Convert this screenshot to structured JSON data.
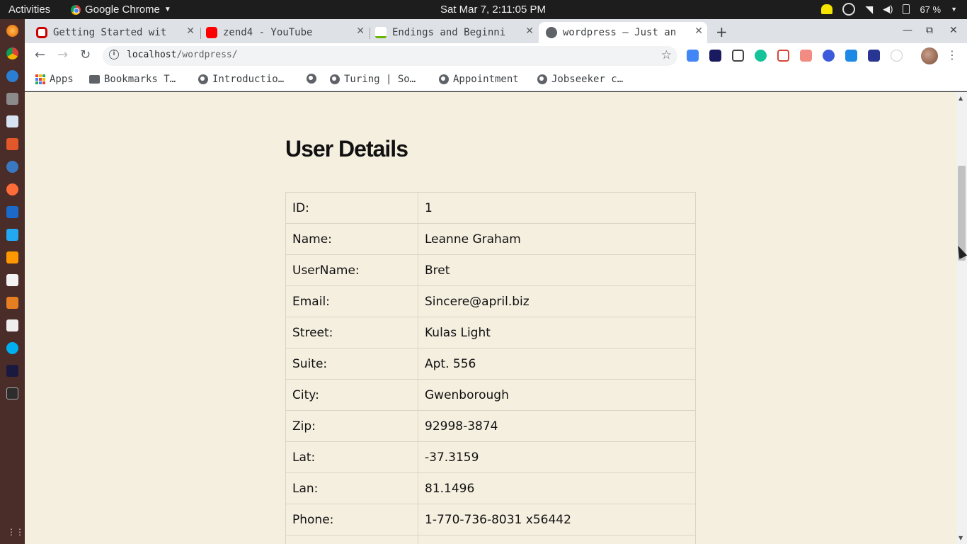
{
  "topbar": {
    "activities": "Activities",
    "app_name": "Google Chrome",
    "clock": "Sat Mar  7,  2:11:05 PM",
    "battery": "67 %"
  },
  "tabs": [
    {
      "title": "Getting Started wit",
      "icon": "oracle-icon"
    },
    {
      "title": "zend4 - YouTube",
      "icon": "youtube-icon"
    },
    {
      "title": "Endings and Beginni",
      "icon": "zend-icon"
    },
    {
      "title": "wordpress – Just an",
      "icon": "globe-icon",
      "active": true
    }
  ],
  "omnibox": {
    "host": "localhost",
    "path": "/wordpress/"
  },
  "bookmarks": [
    {
      "label": "Apps",
      "icon": "apps-grid-icon"
    },
    {
      "label": "Bookmarks T…",
      "icon": "folder-icon"
    },
    {
      "label": "Introductio…",
      "icon": "globe-icon"
    },
    {
      "label": "",
      "icon": "globe-icon"
    },
    {
      "label": "Turing | So…",
      "icon": "globe-icon"
    },
    {
      "label": "Appointment",
      "icon": "globe-icon"
    },
    {
      "label": "Jobseeker c…",
      "icon": "globe-icon"
    }
  ],
  "page": {
    "heading": "User Details",
    "rows": [
      {
        "key": "ID:",
        "value": "1"
      },
      {
        "key": "Name:",
        "value": "Leanne Graham"
      },
      {
        "key": "UserName:",
        "value": "Bret"
      },
      {
        "key": "Email:",
        "value": "Sincere@april.biz"
      },
      {
        "key": "Street:",
        "value": "Kulas Light"
      },
      {
        "key": "Suite:",
        "value": "Apt. 556"
      },
      {
        "key": "City:",
        "value": "Gwenborough"
      },
      {
        "key": "Zip:",
        "value": "92998-3874"
      },
      {
        "key": "Lat:",
        "value": "-37.3159"
      },
      {
        "key": "Lan:",
        "value": "81.1496"
      },
      {
        "key": "Phone:",
        "value": "1-770-736-8031 x56442"
      },
      {
        "key": "",
        "value": ""
      }
    ]
  },
  "colors": {
    "page_bg": "#f5efe0",
    "tabstrip_bg": "#dee1e6",
    "dock_bg": "#4a2c28"
  }
}
